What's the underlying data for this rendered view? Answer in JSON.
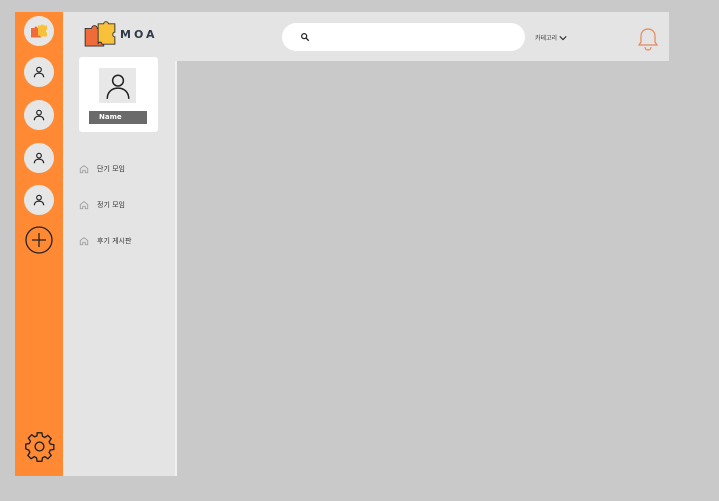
{
  "app": {
    "logo_text": "MOA"
  },
  "profile": {
    "name": "Name"
  },
  "menu": [
    {
      "label": "단기 모임",
      "icon": "home-icon"
    },
    {
      "label": "정기 모임",
      "icon": "home-icon"
    },
    {
      "label": "후기 게시판",
      "icon": "home-icon"
    }
  ],
  "header": {
    "search_placeholder": "",
    "category_label": "카테고리"
  },
  "colors": {
    "rail": "#ff8a33",
    "panel": "#e4e4e4",
    "background": "#c9c9c9",
    "bell": "#e8875a"
  }
}
